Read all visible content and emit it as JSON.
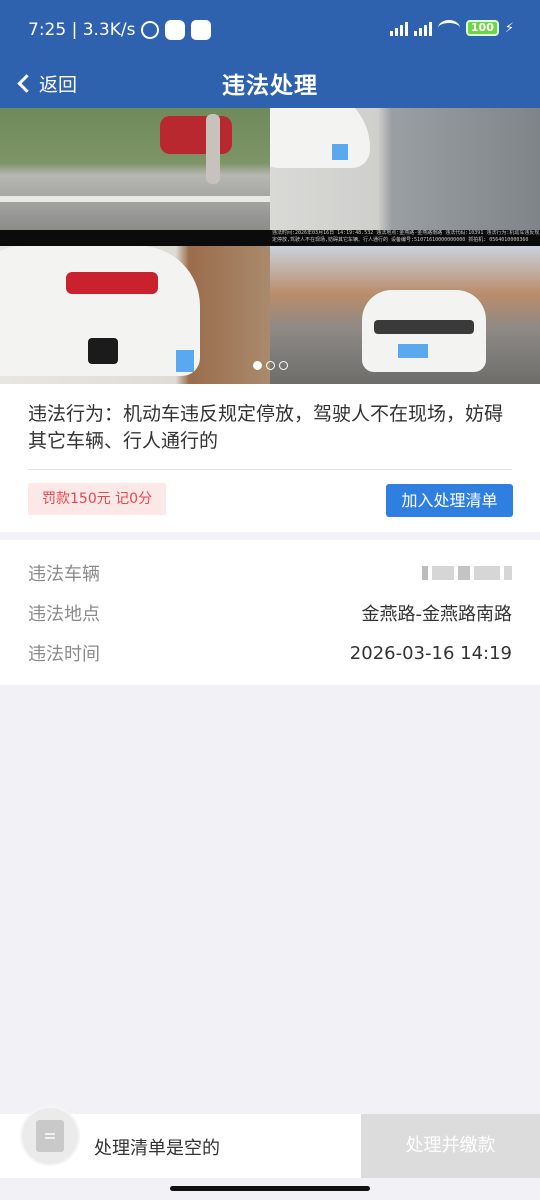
{
  "status_bar": {
    "time_speed": "7:25 | 3.3K/s",
    "battery": "100"
  },
  "header": {
    "back_label": "返回",
    "title": "违法处理"
  },
  "violation": {
    "behavior": "违法行为：机动车违反规定停放，驾驶人不在现场，妨碍其它车辆、行人通行的",
    "penalty_badge": "罚款150元 记0分",
    "add_button_label": "加入处理清单"
  },
  "photo_caption": "违法时间:2026年03月16日 14:19:48.532 违法地点:金燕路-金燕路南路 违法代码:10391 违法行为:机动车违反规定停放,驾驶人不在现场,妨碍其它车辆、行人通行的 设备编号:51071610000000000 抓拍机: 0564010000360",
  "carousel": {
    "page_count": 3,
    "active_index": 0
  },
  "details": {
    "rows": [
      {
        "label": "违法车辆",
        "value": ""
      },
      {
        "label": "违法地点",
        "value": "金燕路-金燕路南路"
      },
      {
        "label": "违法时间",
        "value": "2026-03-16 14:19"
      }
    ]
  },
  "footer": {
    "empty_list_text": "处理清单是空的",
    "pay_button_label": "处理并缴款"
  },
  "colors": {
    "primary": "#2e62ae",
    "button": "#2f7fe0",
    "penalty": "#e5484d",
    "disabled": "#dcdcdc"
  },
  "icons": [
    "back-chevron-icon",
    "alarm-icon",
    "signal-icon",
    "wifi-icon",
    "battery-icon",
    "charging-icon",
    "list-icon"
  ]
}
